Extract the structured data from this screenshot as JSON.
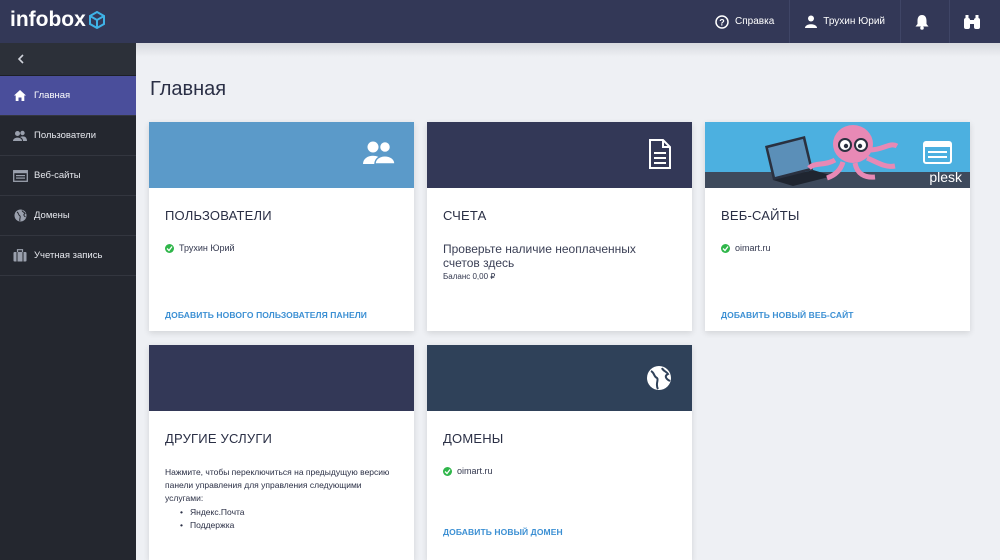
{
  "header": {
    "logo": "infobox",
    "help_label": "Справка",
    "user_label": "Трухин Юрий"
  },
  "sidebar": {
    "items": [
      {
        "label": "Главная",
        "icon": "home-icon"
      },
      {
        "label": "Пользователи",
        "icon": "users-icon"
      },
      {
        "label": "Веб-сайты",
        "icon": "browser-icon"
      },
      {
        "label": "Домены",
        "icon": "globe-icon"
      },
      {
        "label": "Учетная запись",
        "icon": "briefcase-icon"
      }
    ]
  },
  "main": {
    "title": "Главная",
    "cards": {
      "users": {
        "title": "ПОЛЬЗОВАТЕЛИ",
        "status": "Трухин Юрий",
        "link": "ДОБАВИТЬ НОВОГО ПОЛЬЗОВАТЕЛЯ ПАНЕЛИ",
        "color": "#5b9ac9"
      },
      "bills": {
        "title": "СЧЕТА",
        "text": "Проверьте наличие неоплаченных счетов здесь",
        "balance": "Баланс 0,00 ₽",
        "color": "#333857"
      },
      "websites": {
        "title": "ВЕБ-САЙТЫ",
        "status": "oimart.ru",
        "link": "ДОБАВИТЬ НОВЫЙ ВЕБ-САЙТ",
        "banner_text": "plesk",
        "color": "#4cb0e0"
      },
      "other": {
        "title": "ДРУГИЕ УСЛУГИ",
        "text": "Нажмите, чтобы переключиться на предыдущую версию панели управления для управления следующими услугами:",
        "items": [
          "Яндекс.Почта",
          "Поддержка"
        ],
        "color": "#333857"
      },
      "domains": {
        "title": "ДОМЕНЫ",
        "status": "oimart.ru",
        "link": "ДОБАВИТЬ НОВЫЙ ДОМЕН",
        "color": "#2f4159"
      }
    }
  },
  "colors": {
    "accent": "#4a4e9b",
    "link": "#3b8fd3",
    "ok": "#2fb64a",
    "topbar": "#333857",
    "sidebar": "#24272f"
  }
}
